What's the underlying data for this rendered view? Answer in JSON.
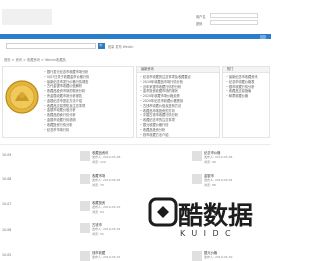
{
  "header": {
    "login": [
      {
        "label": "用户名"
      },
      {
        "label": "密码"
      },
      {
        "label": "登录"
      }
    ]
  },
  "search": {
    "placeholder": "",
    "button": "🔍",
    "hot": "批量  发布  Weixin"
  },
  "breadcrumb": "首页 > 资讯 > 收藏资讯 > Weixin收藏品",
  "panels": {
    "left_list": [
      "银行发行纪念币收藏市场分析",
      "5月7日关于收藏金币价格行情",
      "最新纪念币发行价格行情调查",
      "古代金银币收藏价值解析",
      "收藏品投资市场的现状分析",
      "贵金属收藏市场分析报告",
      "金银纪念币鉴定方法介绍",
      "收藏品交易须知及注意事项",
      "金银币收藏价值分析",
      "收藏品拍卖行情分析",
      "金银币收藏行情说明",
      "收藏投资行情分析",
      "纪念币市场行情"
    ],
    "mid_title": "最新资讯",
    "mid_list": [
      "纪念币收藏的注意事项及收藏要点",
      "2019年收藏品市场行情分析",
      "近年来银币收藏行情的分析",
      "金币投资收藏市场的现状",
      "2020年收藏市场价格走势",
      "2020年纪念币收藏价格预测",
      "古钱币收藏价值及鉴别方法",
      "收藏品市场投资的方向",
      "中国古钱币收藏行情分析",
      "收藏纪念币的注意事项",
      "银元收藏价格行情",
      "收藏品投资分析",
      "钱币收藏方法介绍"
    ],
    "right_title": "热门",
    "right_list": [
      "最新纪念币收藏资讯",
      "纪念币收藏价格表",
      "银币收藏行情分析",
      "收藏品交易指南",
      "邮票收藏价格"
    ]
  },
  "cards": [
    {
      "title": "收藏品资讯",
      "meta": "发布人: 2019-05-08",
      "sub": "浏览: 120"
    },
    {
      "title": "纪念币价格",
      "meta": "发布人: 2019-05-06",
      "sub": "浏览: 98"
    },
    {
      "title": "收藏市场",
      "meta": "发布人: 2019-05-05",
      "sub": "浏览: 76"
    },
    {
      "title": "金银币",
      "meta": "发布人: 2019-05-04",
      "sub": "浏览: 88"
    },
    {
      "title": "收藏投资",
      "meta": "发布人: 2019-05-03",
      "sub": "浏览: 64"
    },
    {
      "title": "古钱币",
      "meta": "发布人: 2019-05-02",
      "sub": "浏览: 55"
    },
    {
      "title": "钱币收藏",
      "meta": "发布人: 2019-05-01",
      "sub": "浏览: 43"
    },
    {
      "title": "银元价格",
      "meta": "发布人: 2019-04-30",
      "sub": "浏览: 39"
    }
  ],
  "side_labels": [
    "10-09",
    "10-08",
    "10-07",
    "10-06",
    "10-05"
  ],
  "watermark": {
    "main": "酷数据",
    "sub": "KUIDC"
  }
}
